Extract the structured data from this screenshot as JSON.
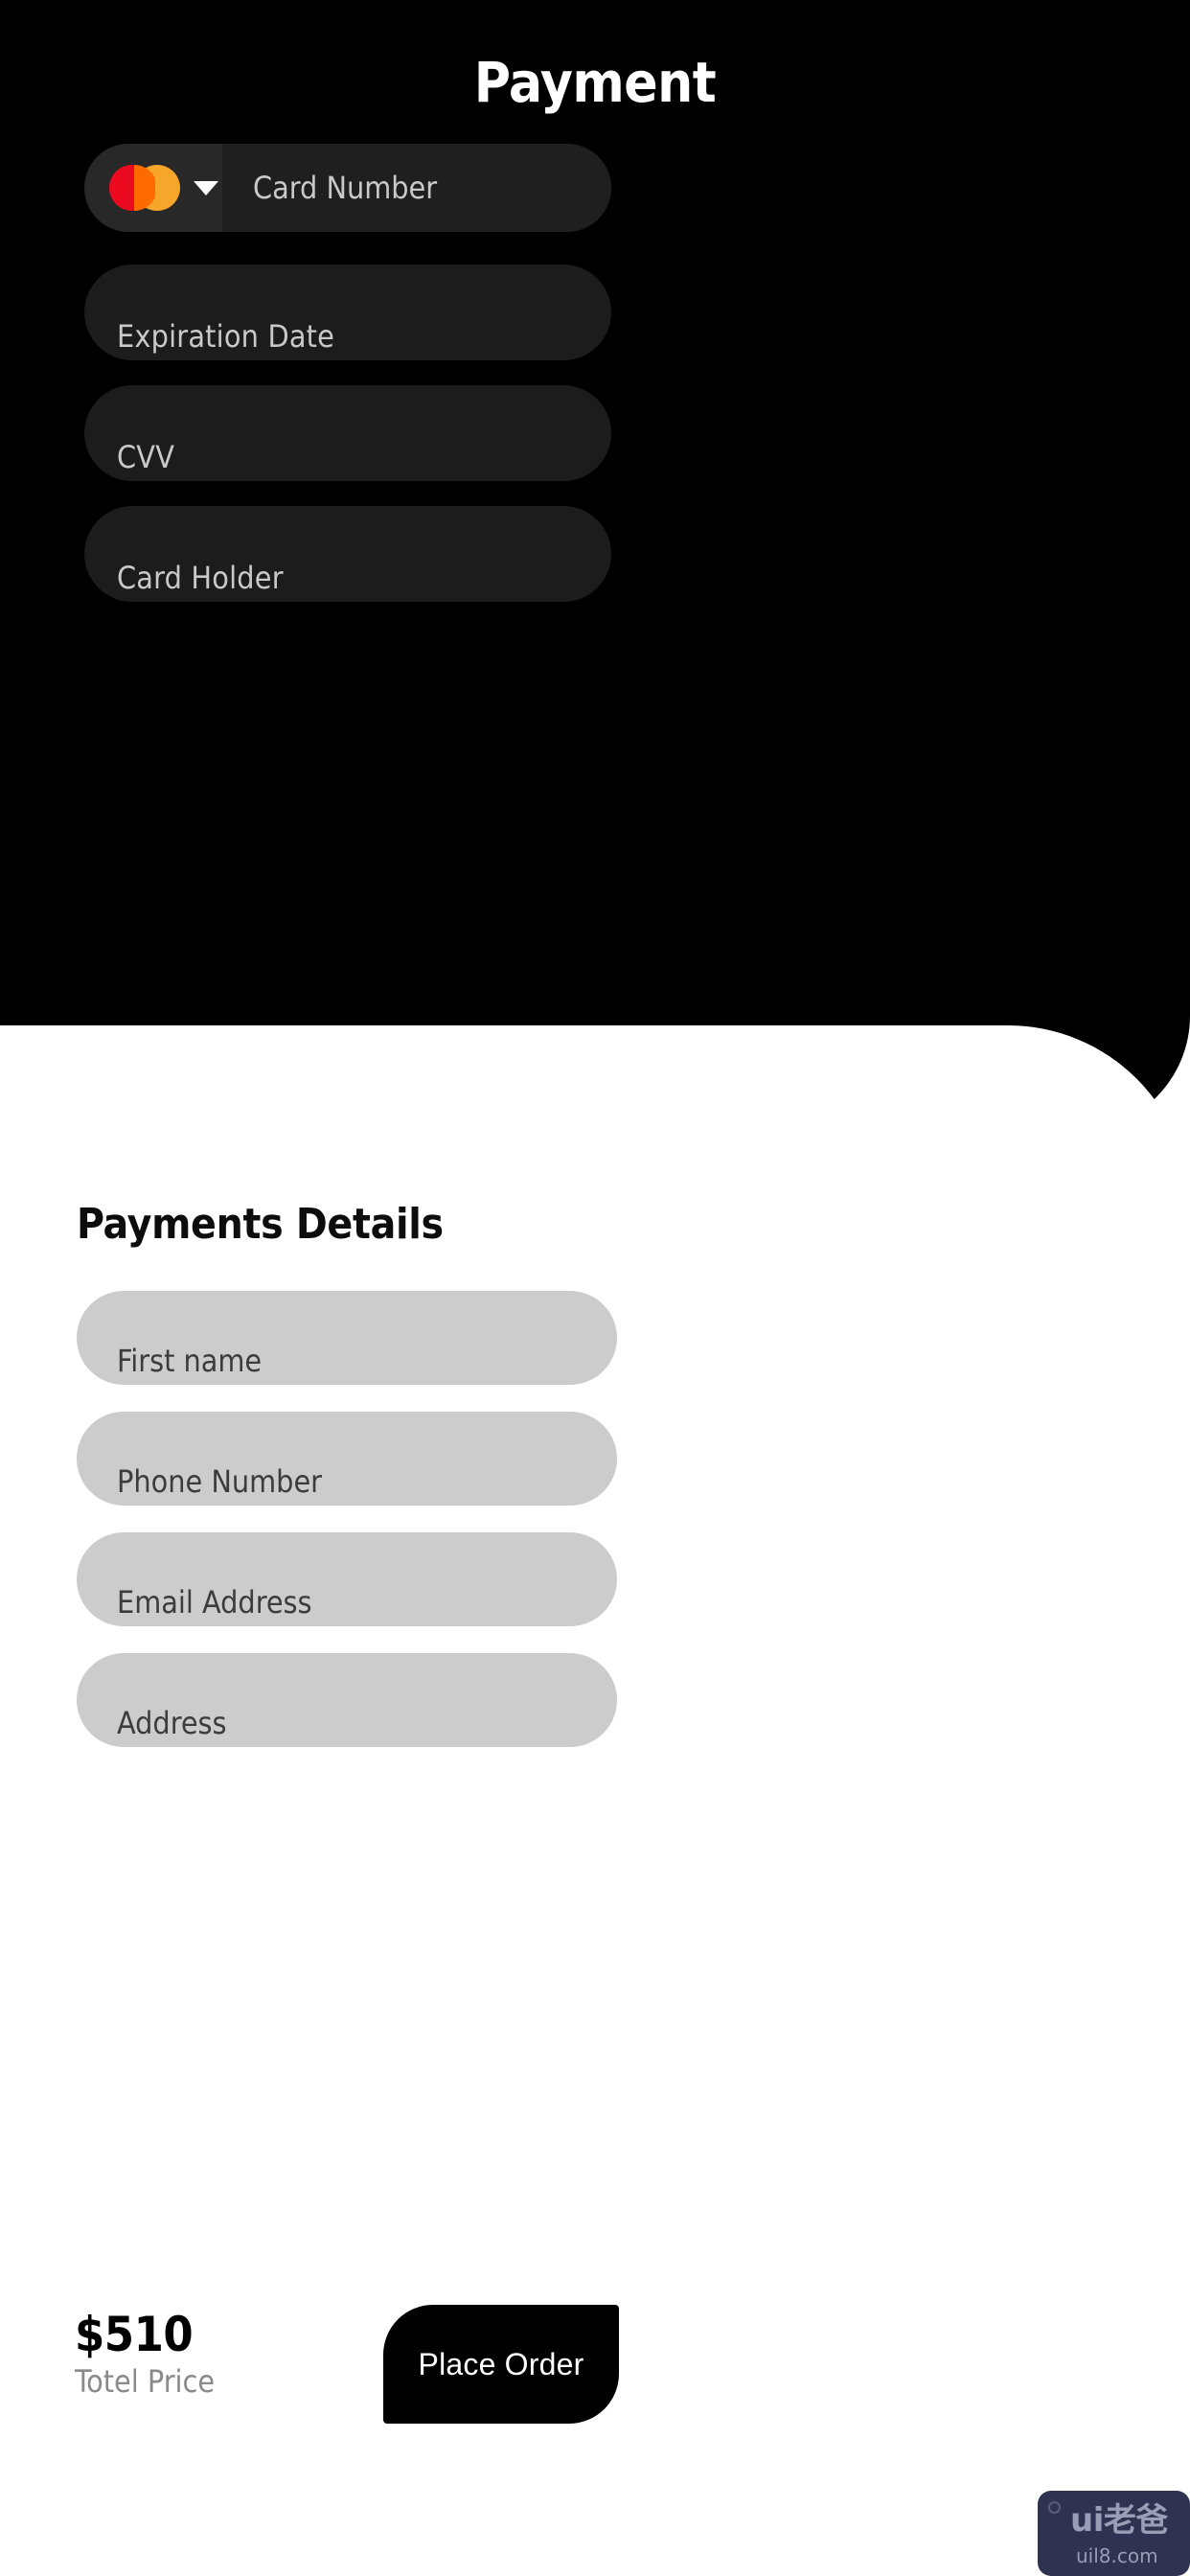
{
  "header": {
    "title": "Payment"
  },
  "card_section": {
    "brand_selector": {
      "brand": "mastercard",
      "caret_icon": "chevron-down-icon"
    },
    "fields": [
      {
        "name": "card-number",
        "placeholder": "Card Number"
      },
      {
        "name": "expiration-date",
        "placeholder": "Expiration Date"
      },
      {
        "name": "cvv",
        "placeholder": "CVV"
      },
      {
        "name": "card-holder",
        "placeholder": "Card Holder"
      }
    ]
  },
  "details_section": {
    "title": "Payments Details",
    "fields": [
      {
        "name": "first-name",
        "placeholder": "First name"
      },
      {
        "name": "phone-number",
        "placeholder": "Phone Number"
      },
      {
        "name": "email-address",
        "placeholder": "Email Address"
      },
      {
        "name": "address",
        "placeholder": "Address"
      }
    ]
  },
  "footer": {
    "price_amount": "$510",
    "price_label": "Totel Price",
    "place_order_label": "Place Order"
  },
  "watermark": {
    "main": "ui老爸",
    "sub": "uil8.com"
  },
  "colors": {
    "panel_black": "#000000",
    "dark_field": "#1c1c1c",
    "brand_segment": "#282828",
    "input_segment": "#1f1f1f",
    "light_field": "#cccccc",
    "dark_placeholder": "#c9c9c9",
    "light_placeholder": "#3c3c3c",
    "price_label": "#8a8a8a",
    "mastercard_red": "#ec0a20",
    "mastercard_amber": "#f5a62b",
    "mastercard_overlap": "#ff6b00",
    "watermark_bg": "#2f3250"
  }
}
